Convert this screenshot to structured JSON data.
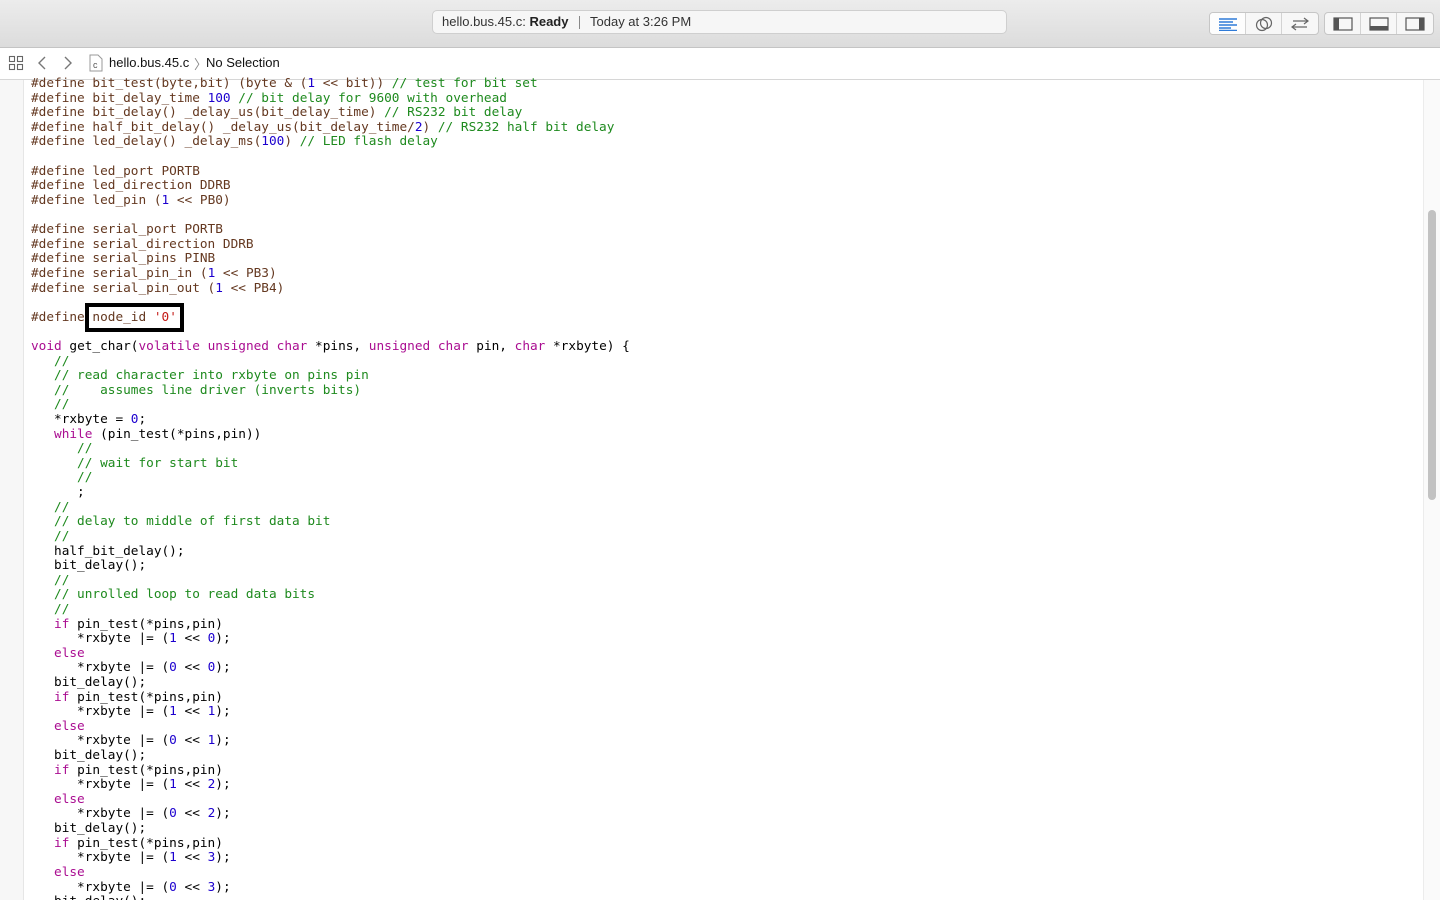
{
  "window": {
    "activity": {
      "filename": "hello.bus.45.c: ",
      "state": "Ready",
      "timestamp": "Today at 3:26 PM"
    },
    "toolbar_icons": [
      "standard-editor-icon",
      "assistant-editor-icon",
      "version-editor-icon",
      "navigator-toggle-icon",
      "debug-area-toggle-icon",
      "utilities-toggle-icon"
    ]
  },
  "jumpbar": {
    "file": "hello.bus.45.c",
    "selection": "No Selection",
    "chevron": "〉",
    "file_badge": "c"
  },
  "colors": {
    "preprocessor": "#643820",
    "comment": "#1e8a1e",
    "keyword": "#aa0d91",
    "number": "#1c00cf",
    "string": "#c41a16"
  },
  "code_lines": [
    [
      [
        "pp",
        "#define bit_test(byte,bit) (byte & ("
      ],
      [
        "nm",
        "1"
      ],
      [
        "pp",
        " << bit)) "
      ],
      [
        "cm",
        "// test for bit set"
      ]
    ],
    [
      [
        "pp",
        "#define bit_delay_time "
      ],
      [
        "nm",
        "100"
      ],
      [
        "pp",
        " "
      ],
      [
        "cm",
        "// bit delay for 9600 with overhead"
      ]
    ],
    [
      [
        "pp",
        "#define bit_delay() _delay_us(bit_delay_time) "
      ],
      [
        "cm",
        "// RS232 bit delay"
      ]
    ],
    [
      [
        "pp",
        "#define half_bit_delay() _delay_us(bit_delay_time/"
      ],
      [
        "nm",
        "2"
      ],
      [
        "pp",
        ") "
      ],
      [
        "cm",
        "// RS232 half bit delay"
      ]
    ],
    [
      [
        "pp",
        "#define led_delay() _delay_ms("
      ],
      [
        "nm",
        "100"
      ],
      [
        "pp",
        ") "
      ],
      [
        "cm",
        "// LED flash delay"
      ]
    ],
    [],
    [
      [
        "pp",
        "#define led_port PORTB"
      ]
    ],
    [
      [
        "pp",
        "#define led_direction DDRB"
      ]
    ],
    [
      [
        "pp",
        "#define led_pin ("
      ],
      [
        "nm",
        "1"
      ],
      [
        "pp",
        " << PB0)"
      ]
    ],
    [],
    [
      [
        "pp",
        "#define serial_port PORTB"
      ]
    ],
    [
      [
        "pp",
        "#define serial_direction DDRB"
      ]
    ],
    [
      [
        "pp",
        "#define serial_pins PINB"
      ]
    ],
    [
      [
        "pp",
        "#define serial_pin_in ("
      ],
      [
        "nm",
        "1"
      ],
      [
        "pp",
        " << PB3)"
      ]
    ],
    [
      [
        "pp",
        "#define serial_pin_out ("
      ],
      [
        "nm",
        "1"
      ],
      [
        "pp",
        " << PB4)"
      ]
    ],
    [],
    [
      [
        "pp",
        "#define "
      ],
      [
        "hl",
        "node_id "
      ],
      [
        "st",
        "'0'"
      ]
    ],
    [],
    [
      [
        "kw",
        "void"
      ],
      [
        "tx",
        " get_char("
      ],
      [
        "kw",
        "volatile unsigned char"
      ],
      [
        "tx",
        " *pins, "
      ],
      [
        "kw",
        "unsigned char"
      ],
      [
        "tx",
        " pin, "
      ],
      [
        "kw",
        "char"
      ],
      [
        "tx",
        " *rxbyte) {"
      ]
    ],
    [
      [
        "cm",
        "   //"
      ]
    ],
    [
      [
        "cm",
        "   // read character into rxbyte on pins pin"
      ]
    ],
    [
      [
        "cm",
        "   //    assumes line driver (inverts bits)"
      ]
    ],
    [
      [
        "cm",
        "   //"
      ]
    ],
    [
      [
        "tx",
        "   *rxbyte = "
      ],
      [
        "nm",
        "0"
      ],
      [
        "tx",
        ";"
      ]
    ],
    [
      [
        "kw",
        "   while"
      ],
      [
        "tx",
        " (pin_test(*pins,pin))"
      ]
    ],
    [
      [
        "cm",
        "      //"
      ]
    ],
    [
      [
        "cm",
        "      // wait for start bit"
      ]
    ],
    [
      [
        "cm",
        "      //"
      ]
    ],
    [
      [
        "tx",
        "      ;"
      ]
    ],
    [
      [
        "cm",
        "   //"
      ]
    ],
    [
      [
        "cm",
        "   // delay to middle of first data bit"
      ]
    ],
    [
      [
        "cm",
        "   //"
      ]
    ],
    [
      [
        "tx",
        "   half_bit_delay();"
      ]
    ],
    [
      [
        "tx",
        "   bit_delay();"
      ]
    ],
    [
      [
        "cm",
        "   //"
      ]
    ],
    [
      [
        "cm",
        "   // unrolled loop to read data bits"
      ]
    ],
    [
      [
        "cm",
        "   //"
      ]
    ],
    [
      [
        "kw",
        "   if"
      ],
      [
        "tx",
        " pin_test(*pins,pin)"
      ]
    ],
    [
      [
        "tx",
        "      *rxbyte |= ("
      ],
      [
        "nm",
        "1"
      ],
      [
        "tx",
        " << "
      ],
      [
        "nm",
        "0"
      ],
      [
        "tx",
        ");"
      ]
    ],
    [
      [
        "kw",
        "   else"
      ]
    ],
    [
      [
        "tx",
        "      *rxbyte |= ("
      ],
      [
        "nm",
        "0"
      ],
      [
        "tx",
        " << "
      ],
      [
        "nm",
        "0"
      ],
      [
        "tx",
        ");"
      ]
    ],
    [
      [
        "tx",
        "   bit_delay();"
      ]
    ],
    [
      [
        "kw",
        "   if"
      ],
      [
        "tx",
        " pin_test(*pins,pin)"
      ]
    ],
    [
      [
        "tx",
        "      *rxbyte |= ("
      ],
      [
        "nm",
        "1"
      ],
      [
        "tx",
        " << "
      ],
      [
        "nm",
        "1"
      ],
      [
        "tx",
        ");"
      ]
    ],
    [
      [
        "kw",
        "   else"
      ]
    ],
    [
      [
        "tx",
        "      *rxbyte |= ("
      ],
      [
        "nm",
        "0"
      ],
      [
        "tx",
        " << "
      ],
      [
        "nm",
        "1"
      ],
      [
        "tx",
        ");"
      ]
    ],
    [
      [
        "tx",
        "   bit_delay();"
      ]
    ],
    [
      [
        "kw",
        "   if"
      ],
      [
        "tx",
        " pin_test(*pins,pin)"
      ]
    ],
    [
      [
        "tx",
        "      *rxbyte |= ("
      ],
      [
        "nm",
        "1"
      ],
      [
        "tx",
        " << "
      ],
      [
        "nm",
        "2"
      ],
      [
        "tx",
        ");"
      ]
    ],
    [
      [
        "kw",
        "   else"
      ]
    ],
    [
      [
        "tx",
        "      *rxbyte |= ("
      ],
      [
        "nm",
        "0"
      ],
      [
        "tx",
        " << "
      ],
      [
        "nm",
        "2"
      ],
      [
        "tx",
        ");"
      ]
    ],
    [
      [
        "tx",
        "   bit_delay();"
      ]
    ],
    [
      [
        "kw",
        "   if"
      ],
      [
        "tx",
        " pin_test(*pins,pin)"
      ]
    ],
    [
      [
        "tx",
        "      *rxbyte |= ("
      ],
      [
        "nm",
        "1"
      ],
      [
        "tx",
        " << "
      ],
      [
        "nm",
        "3"
      ],
      [
        "tx",
        ");"
      ]
    ],
    [
      [
        "kw",
        "   else"
      ]
    ],
    [
      [
        "tx",
        "      *rxbyte |= ("
      ],
      [
        "nm",
        "0"
      ],
      [
        "tx",
        " << "
      ],
      [
        "nm",
        "3"
      ],
      [
        "tx",
        ");"
      ]
    ],
    [
      [
        "tx",
        "   bit_delay();"
      ]
    ]
  ]
}
